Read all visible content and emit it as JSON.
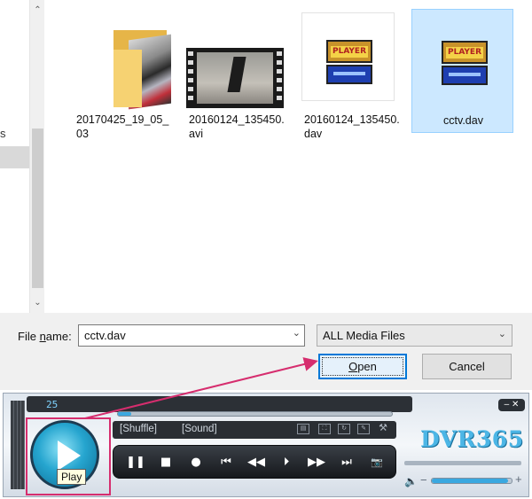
{
  "dialog": {
    "left_pane_partial_text": "s",
    "files": [
      {
        "name": "20170425_19_05_03",
        "type": "folder",
        "selected": false
      },
      {
        "name": "20160124_135450.avi",
        "type": "video",
        "selected": false
      },
      {
        "name": "20160124_135450.dav",
        "type": "player-file",
        "selected": false
      },
      {
        "name": "cctv.dav",
        "type": "player-file",
        "selected": true
      }
    ],
    "player_logo_text": "PLAYER",
    "filename_label_prefix": "File ",
    "filename_label_underlined": "n",
    "filename_label_suffix": "ame:",
    "filename_value": "cctv.dav",
    "filetype_value": "ALL Media Files",
    "open_label_underlined": "O",
    "open_label_rest": "pen",
    "cancel_label": "Cancel"
  },
  "player": {
    "counter": "25",
    "progress_fraction": 0.05,
    "shuffle_label": "[Shuffle]",
    "sound_label": "[Sound]",
    "brand": "DVR365",
    "tooltip": "Play",
    "volume_fraction": 0.95,
    "controls": [
      {
        "name": "pause-button",
        "glyph": "❚❚"
      },
      {
        "name": "stop-button",
        "glyph": "■"
      },
      {
        "name": "record-button",
        "glyph": "●"
      },
      {
        "name": "previous-button",
        "glyph": "⏮"
      },
      {
        "name": "rewind-button",
        "glyph": "◀◀"
      },
      {
        "name": "frame-step-button",
        "glyph": "⏵"
      },
      {
        "name": "fast-forward-button",
        "glyph": "▶▶"
      },
      {
        "name": "next-button",
        "glyph": "⏭"
      },
      {
        "name": "snapshot-button",
        "glyph": "📷"
      }
    ],
    "accent_color": "#3aa8e0",
    "highlight_color": "#d62d6e"
  }
}
